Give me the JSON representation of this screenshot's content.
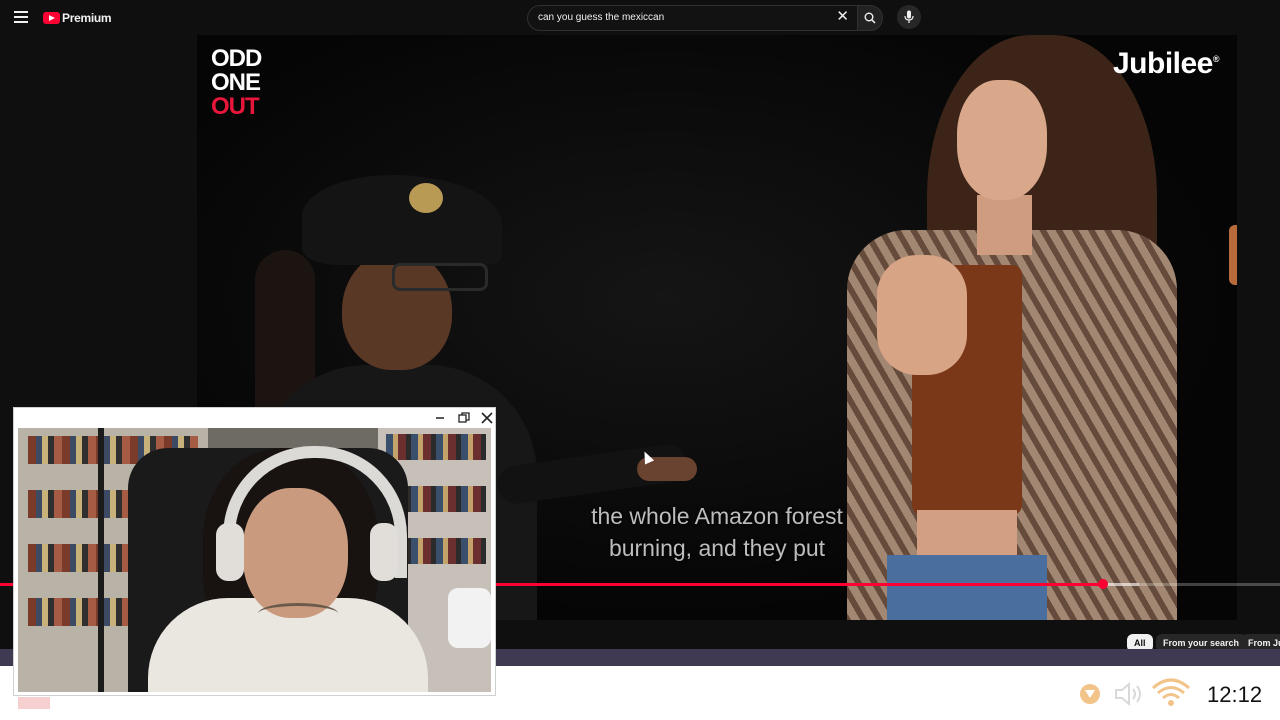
{
  "header": {
    "logo_text": "Premium",
    "search_value": "can you guess the mexiccan",
    "search_clear_icon": "close-icon",
    "search_icon": "search-icon",
    "voice_icon": "microphone-icon"
  },
  "video": {
    "show_logo": [
      "ODD",
      "ONE",
      "OUT"
    ],
    "channel_watermark": "Jubilee",
    "caption_lines": [
      "the whole Amazon forest",
      "burning, and they put"
    ],
    "progress_fraction": 0.862,
    "buffered_fraction": 0.89,
    "accent_color": "#ff0033"
  },
  "chips": [
    "All",
    "From your search",
    "From Ju"
  ],
  "pip": {
    "controls": [
      "minimize-icon",
      "restore-icon",
      "close-icon"
    ]
  },
  "taskbar": {
    "tray_icons": [
      "warning-icon",
      "volume-icon",
      "wifi-icon"
    ],
    "clock": "12:12"
  }
}
